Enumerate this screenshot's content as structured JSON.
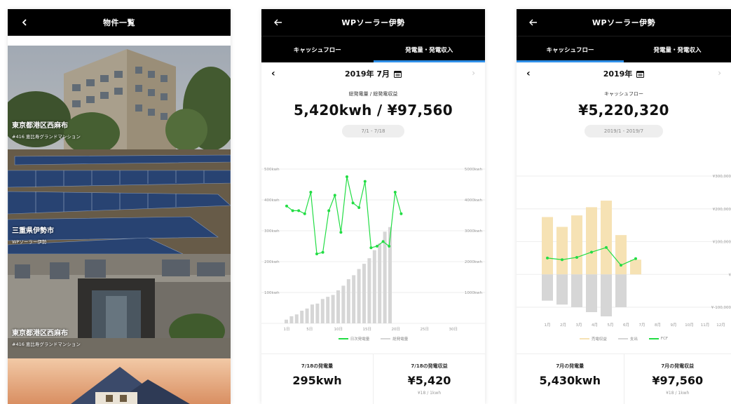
{
  "list_screen": {
    "title": "物件一覧",
    "properties": [
      {
        "area": "東京都港区西麻布",
        "name": "#416 恵比寿グランドマンション"
      },
      {
        "area": "三重県伊勢市",
        "name": "WPソーラー伊勢"
      },
      {
        "area": "東京都港区西麻布",
        "name": "#416 恵比寿グランドマンション"
      },
      {
        "area": "",
        "name": ""
      }
    ]
  },
  "power_screen": {
    "title": "WPソーラー伊勢",
    "tabs": [
      "キャッシュフロー",
      "発電量・発電収入"
    ],
    "active_tab": 1,
    "date": "2019年 7月",
    "summary_label": "総発電量 / 総発電収益",
    "summary_value": "5,420kwh / ¥97,560",
    "range": "7/1 - 7/18",
    "bottom": [
      {
        "label": "7/18の発電量",
        "value": "295kwh",
        "sub": ""
      },
      {
        "label": "7/18の発電収益",
        "value": "¥5,420",
        "sub": "¥18 / 1kwh"
      }
    ]
  },
  "cashflow_screen": {
    "title": "WPソーラー伊勢",
    "tabs": [
      "キャッシュフロー",
      "発電量・発電収入"
    ],
    "active_tab": 0,
    "date": "2019年",
    "summary_label": "キャッシュフロー",
    "summary_value": "¥5,220,320",
    "range": "2019/1 - 2019/7",
    "bottom": [
      {
        "label": "7月の発電量",
        "value": "5,430kwh",
        "sub": ""
      },
      {
        "label": "7月の発電収益",
        "value": "¥97,560",
        "sub": "¥18 / 1kwh"
      }
    ]
  },
  "colors": {
    "accent": "#2f8fe8",
    "line_green": "#22dd44",
    "bar_gray": "#d6d6d6",
    "bar_beige": "#f6e2b4"
  },
  "chart_data": [
    {
      "type": "bar",
      "title": "",
      "x_tick_labels": [
        "1日",
        "5日",
        "10日",
        "15日",
        "20日",
        "25日",
        "30日"
      ],
      "y_left_ticks": [
        "500kwh",
        "400kwh",
        "300kwh",
        "200kwh",
        "100kwh"
      ],
      "y_right_ticks": [
        "5000kwh",
        "4000kwh",
        "3000kwh",
        "2000kwh",
        "1000kwh"
      ],
      "y_left_range": [
        0,
        500
      ],
      "y_right_range": [
        0,
        5000
      ],
      "x": [
        1,
        2,
        3,
        4,
        5,
        6,
        7,
        8,
        9,
        10,
        11,
        12,
        13,
        14,
        15,
        16,
        17,
        18
      ],
      "series": [
        {
          "name": "日次発電量",
          "kind": "line",
          "axis": "left",
          "values": [
            380,
            365,
            365,
            355,
            425,
            225,
            230,
            365,
            415,
            295,
            475,
            390,
            375,
            460,
            245,
            250,
            265,
            250,
            425,
            355
          ]
        },
        {
          "name": "総発電量",
          "kind": "bar",
          "axis": "right",
          "values": [
            120,
            230,
            290,
            410,
            480,
            610,
            640,
            790,
            860,
            920,
            1070,
            1220,
            1430,
            1560,
            1760,
            1930,
            2110,
            2370,
            2590,
            2970,
            3120
          ]
        }
      ]
    },
    {
      "type": "bar",
      "title": "",
      "x_tick_labels": [
        "1月",
        "2月",
        "3月",
        "4月",
        "5月",
        "6月",
        "7月",
        "8月",
        "9月",
        "10月",
        "11月",
        "12月"
      ],
      "y_right_ticks": [
        "¥300,000",
        "¥200,000",
        "¥100,000",
        "¥",
        "¥-100,000"
      ],
      "y_range": [
        -100000,
        300000
      ],
      "series": [
        {
          "name": "売電収益",
          "kind": "bar",
          "values": [
            175000,
            145000,
            180000,
            205000,
            225000,
            120000,
            45000,
            null,
            null,
            null,
            null,
            null
          ]
        },
        {
          "name": "支出",
          "kind": "bar",
          "values": [
            -80000,
            -92000,
            -100000,
            -115000,
            -128000,
            -100000,
            null,
            null,
            null,
            null,
            null,
            null
          ]
        },
        {
          "name": "FCF",
          "kind": "line",
          "values": [
            50000,
            45000,
            52000,
            68000,
            82000,
            28000,
            48000,
            null,
            null,
            null,
            null,
            null
          ]
        }
      ]
    }
  ]
}
